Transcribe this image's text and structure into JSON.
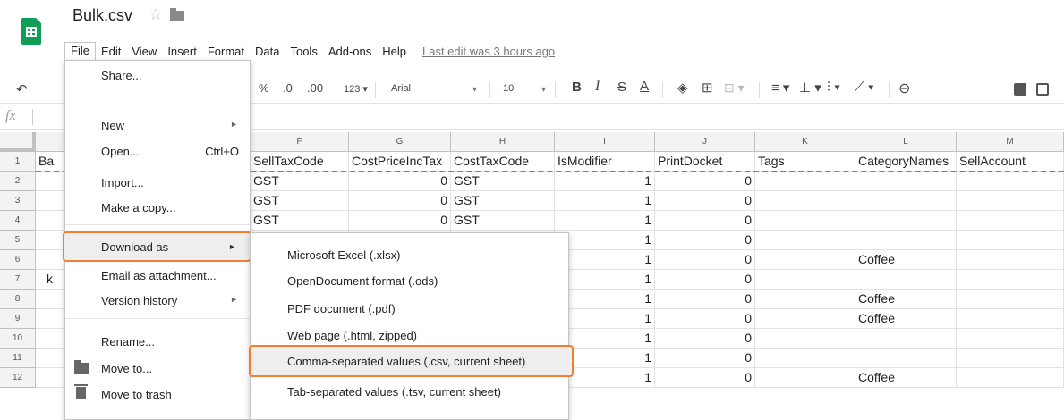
{
  "doc": {
    "title": "Bulk.csv",
    "star_icon": "☆",
    "last_edit": "Last edit was 3 hours ago"
  },
  "menubar": [
    "File",
    "Edit",
    "View",
    "Insert",
    "Format",
    "Data",
    "Tools",
    "Add-ons",
    "Help"
  ],
  "toolbar": {
    "percent": "%",
    "dec_less": ".0",
    "dec_more": ".00",
    "number_format": "123",
    "font": "Arial",
    "font_size": "10",
    "bold": "B",
    "italic": "I",
    "strike": "S",
    "text_color": "A"
  },
  "formula_bar": {
    "fx": "fx"
  },
  "sheet": {
    "columns": [
      "F",
      "G",
      "H",
      "I",
      "J",
      "K",
      "L",
      "M"
    ],
    "rows": [
      "1",
      "2",
      "3",
      "4",
      "5",
      "6",
      "7",
      "8",
      "9",
      "10",
      "11",
      "12"
    ],
    "col_a_fragments": {
      "r1": "Ba",
      "r7": "k"
    },
    "header_row": [
      "SellTaxCode",
      "CostPriceIncTax",
      "CostTaxCode",
      "IsModifier",
      "PrintDocket",
      "Tags",
      "CategoryNames",
      "SellAccount"
    ],
    "cells": [
      [
        "GST",
        "0",
        "GST",
        "1",
        "0",
        "",
        "",
        ""
      ],
      [
        "GST",
        "0",
        "GST",
        "1",
        "0",
        "",
        "",
        ""
      ],
      [
        "GST",
        "0",
        "GST",
        "1",
        "0",
        "",
        "",
        ""
      ],
      [
        "",
        "",
        "",
        "1",
        "0",
        "",
        "",
        ""
      ],
      [
        "",
        "",
        "",
        "1",
        "0",
        "",
        "Coffee",
        ""
      ],
      [
        "",
        "",
        "",
        "1",
        "0",
        "",
        "",
        ""
      ],
      [
        "",
        "",
        "",
        "1",
        "0",
        "",
        "Coffee",
        ""
      ],
      [
        "",
        "",
        "",
        "1",
        "0",
        "",
        "Coffee",
        ""
      ],
      [
        "",
        "",
        "",
        "1",
        "0",
        "",
        "",
        ""
      ],
      [
        "",
        "",
        "",
        "1",
        "0",
        "",
        "",
        ""
      ],
      [
        "",
        "",
        "",
        "1",
        "0",
        "",
        "Coffee",
        ""
      ]
    ]
  },
  "file_menu": {
    "share": "Share...",
    "new": "New",
    "open": "Open...",
    "open_shortcut": "Ctrl+O",
    "import": "Import...",
    "make_copy": "Make a copy...",
    "download_as": "Download as",
    "email_attachment": "Email as attachment...",
    "version_history": "Version history",
    "rename": "Rename...",
    "move_to": "Move to...",
    "move_to_trash": "Move to trash"
  },
  "download_menu": [
    "Microsoft Excel (.xlsx)",
    "OpenDocument format (.ods)",
    "PDF document (.pdf)",
    "Web page (.html, zipped)",
    "Comma-separated values (.csv, current sheet)",
    "Tab-separated values (.tsv, current sheet)"
  ],
  "colors": {
    "accent_orange": "#f08030",
    "sheets_green": "#0f9d58",
    "selection_blue": "#4a89dc"
  }
}
